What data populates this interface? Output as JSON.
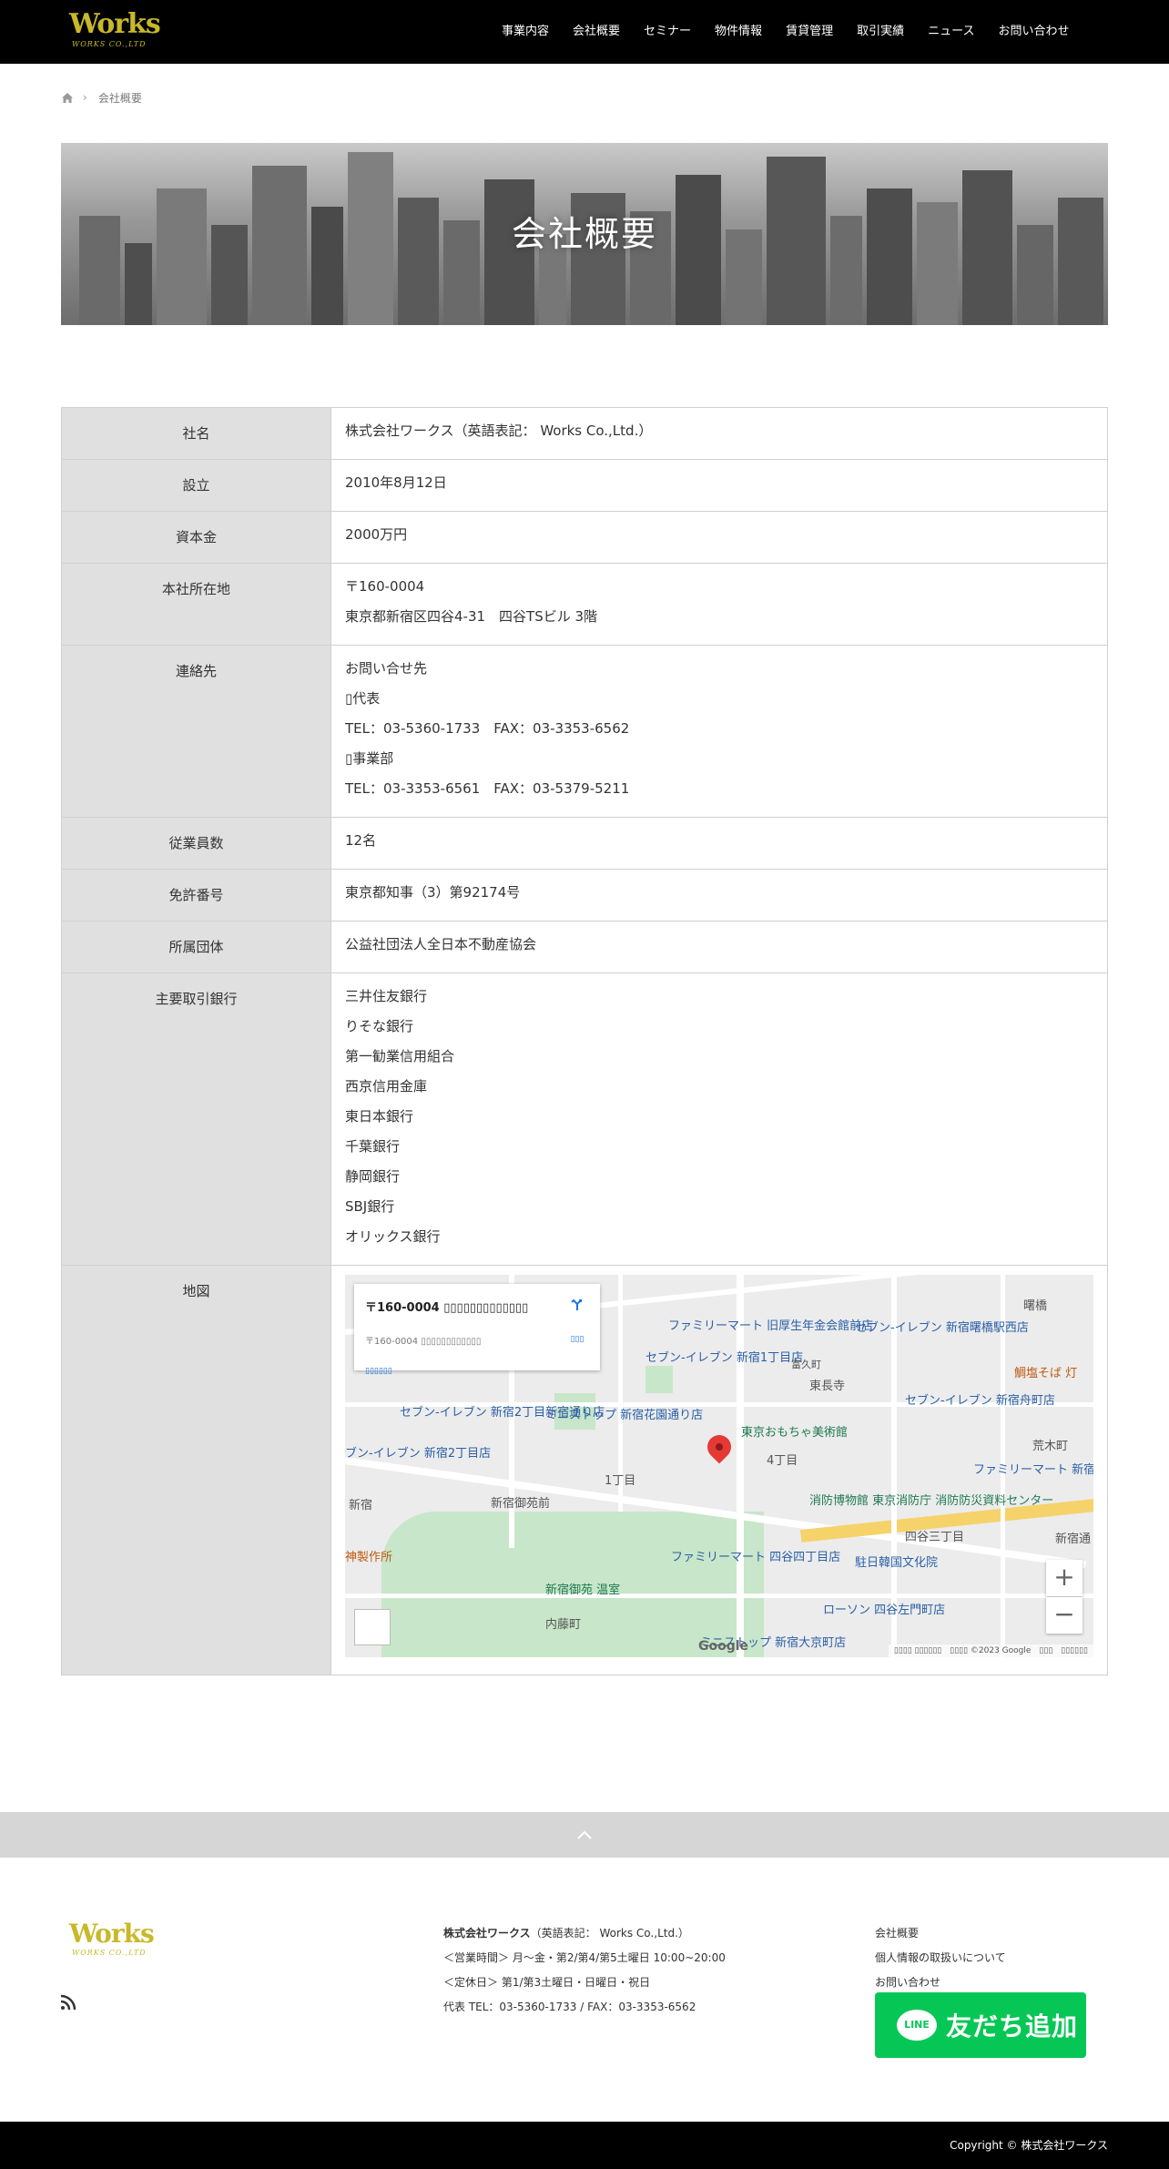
{
  "header": {
    "logo_text": "Works",
    "logo_sub": "WORKS CO.,LTD",
    "nav": [
      "事業内容",
      "会社概要",
      "セミナー",
      "物件情報",
      "賃貸管理",
      "取引実績",
      "ニュース",
      "お問い合わせ"
    ]
  },
  "breadcrumb": {
    "current": "会社概要"
  },
  "hero": {
    "title": "会社概要"
  },
  "company_table": [
    {
      "label": "社名",
      "lines": [
        "株式会社ワークス（英語表記： Works Co.,Ltd.）"
      ]
    },
    {
      "label": "設立",
      "lines": [
        "2010年8月12日"
      ]
    },
    {
      "label": "資本金",
      "lines": [
        "2000万円"
      ]
    },
    {
      "label": "本社所在地",
      "lines": [
        "〒160-0004",
        "東京都新宿区四谷4-31　四谷TSビル 3階"
      ]
    },
    {
      "label": "連絡先",
      "lines": [
        "お問い合せ先",
        "▯代表",
        "TEL：03-5360-1733　FAX：03-3353-6562",
        "▯事業部",
        "TEL：03-3353-6561　FAX：03-5379-5211"
      ]
    },
    {
      "label": "従業員数",
      "lines": [
        "12名"
      ]
    },
    {
      "label": "免許番号",
      "lines": [
        "東京都知事（3）第92174号"
      ]
    },
    {
      "label": "所属団体",
      "lines": [
        "公益社団法人全日本不動産協会"
      ]
    },
    {
      "label": "主要取引銀行",
      "lines": [
        "三井住友銀行",
        "りそな銀行",
        "第一勧業信用組合",
        "西京信用金庫",
        "東日本銀行",
        "千葉銀行",
        "静岡銀行",
        "SBJ銀行",
        "オリックス銀行"
      ]
    }
  ],
  "map_row": {
    "label": "地図",
    "infobox_title": "〒160-0004 ▯▯▯▯▯▯▯▯▯▯▯▯▯",
    "infobox_address": "〒160-0004 ▯▯▯▯▯▯▯▯▯▯▯▯",
    "infobox_link": "▯▯▯▯▯▯",
    "directions": "▯▯▯",
    "labels": [
      "ファミリーマート 旧厚生年金会館前店",
      "セブン-イレブン 新宿1丁目店",
      "セブン-イレブン 新宿曙橋駅西店",
      "東長寺",
      "富久町",
      "曙橋",
      "鯛塩そば 灯",
      "セブン-イレブン 新宿2丁目新宿通り店",
      "ミニストップ 新宿花園通り店",
      "東京おもちゃ美術館",
      "セブン-イレブン 新宿舟町店",
      "荒木町",
      "ブン-イレブン 新宿2丁目店",
      "1丁目",
      "4丁目",
      "ファミリーマート 新宿荒木町店",
      "新宿",
      "新宿御苑前",
      "消防博物館 東京消防庁 消防防災資料センター",
      "四谷三丁目",
      "新宿通",
      "神製作所",
      "ファミリーマート 四谷四丁目店",
      "駐日韓国文化院",
      "新宿御苑 温室",
      "ローソン 四谷左門町店",
      "内藤町",
      "ミニストップ 新宿大京町店"
    ],
    "zoom_in": "+",
    "zoom_out": "−",
    "google": "Google",
    "attribution": "▯▯▯▯ ▯▯▯▯▯▯　▯▯▯▯ ©2023 Google　▯▯▯　▯▯▯▯▯▯"
  },
  "pagetop_icon": "chevron-up",
  "footer": {
    "logo_text": "Works",
    "logo_sub": "WORKS CO.,LTD",
    "company_bold": "株式会社ワークス",
    "company_en": "（英語表記： Works Co.,Ltd.）",
    "hours": "＜営業時間＞ 月〜金・第2/第4/第5土曜日 10:00~20:00",
    "holiday": "＜定休日＞ 第1/第3土曜日・日曜日・祝日",
    "tel": "代表 TEL：03-5360-1733 / FAX：03-3353-6562",
    "links": [
      "会社概要",
      "個人情報の取扱いについて",
      "お問い合わせ"
    ],
    "line_button": "友だち追加",
    "line_icon_text": "LINE",
    "copyright": "Copyright ©  株式会社ワークス"
  },
  "colors": {
    "header_bg": "#000000",
    "logo_gold": "#c8b92a",
    "line_green": "#06c755",
    "table_head_bg": "#e0e0e0"
  }
}
